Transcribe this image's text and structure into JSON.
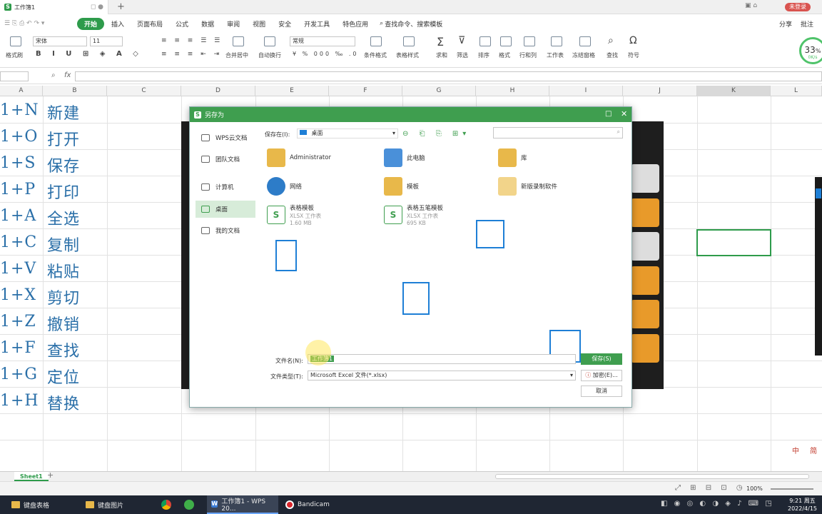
{
  "titlebar": {
    "tab_title": "工作簿1",
    "user_label": "未登录"
  },
  "menu": [
    "开始",
    "插入",
    "页面布局",
    "公式",
    "数据",
    "审阅",
    "视图",
    "安全",
    "开发工具",
    "特色应用"
  ],
  "menu_active": "开始",
  "search": "查找命令、搜索模板",
  "share": "分享",
  "comment": "批注",
  "ribbon": {
    "font": "宋体",
    "size": "11",
    "format": "常规",
    "labels": [
      "格式刷",
      "合并居中",
      "自动换行",
      "条件格式",
      "表格样式",
      "求和",
      "筛选",
      "排序",
      "格式",
      "行和列",
      "工作表",
      "冻结窗格",
      "查找",
      "符号"
    ]
  },
  "speed": {
    "value": "33",
    "unit": "%",
    "rate": "0K/s"
  },
  "formula": {
    "fx": "fx"
  },
  "columns": [
    "A",
    "B",
    "C",
    "D",
    "E",
    "F",
    "G",
    "H",
    "I",
    "J",
    "K",
    "L"
  ],
  "rows": [
    {
      "key": "1+N",
      "name": "新建"
    },
    {
      "key": "1+O",
      "name": "打开"
    },
    {
      "key": "1+S",
      "name": "保存"
    },
    {
      "key": "1+P",
      "name": "打印"
    },
    {
      "key": "1+A",
      "name": "全选"
    },
    {
      "key": "1+C",
      "name": "复制"
    },
    {
      "key": "1+V",
      "name": "粘贴"
    },
    {
      "key": "1+X",
      "name": "剪切"
    },
    {
      "key": "1+Z",
      "name": "撤销"
    },
    {
      "key": "1+F",
      "name": "查找"
    },
    {
      "key": "1+G",
      "name": "定位"
    },
    {
      "key": "1+H",
      "name": "替换"
    }
  ],
  "dialog": {
    "title": "另存为",
    "save_in_label": "保存在(I):",
    "save_in_value": "桌面",
    "sidebar": [
      "WPS云文档",
      "团队文档",
      "计算机",
      "桌面",
      "我的文档"
    ],
    "selected_sidebar": "桌面",
    "files": [
      {
        "name": "Administrator",
        "sub": "",
        "size": ""
      },
      {
        "name": "此电脑",
        "sub": "",
        "size": ""
      },
      {
        "name": "库",
        "sub": "",
        "size": ""
      },
      {
        "name": "网络",
        "sub": "",
        "size": ""
      },
      {
        "name": "模板",
        "sub": "",
        "size": ""
      },
      {
        "name": "新版录制软件",
        "sub": "",
        "size": ""
      },
      {
        "name": "表格模板",
        "sub": "XLSX 工作表",
        "size": "1.60 MB"
      },
      {
        "name": "表格五笔模板",
        "sub": "XLSX 工作表",
        "size": "695 KB"
      }
    ],
    "filename_label": "文件名(N):",
    "filename_value": "工作簿1",
    "filetype_label": "文件类型(T):",
    "filetype_value": "Microsoft Excel 文件(*.xlsx)",
    "save_button": "保存(S)",
    "encrypt_button": "加密(E)...",
    "cancel_button": "取消"
  },
  "sheet": {
    "name": "Sheet1"
  },
  "status": {
    "zoom": "100%"
  },
  "watermark": "中 简",
  "taskbar": {
    "items": [
      "键盘表格",
      "键盘图片",
      "",
      "",
      "工作簿1 - WPS 20...",
      "Bandicam"
    ],
    "time": "9:21 周五",
    "date": "2022/4/15"
  },
  "colors": {
    "accent": "#3f9e4f",
    "highlight": "#1e7fd6",
    "cell_text": "#2a6fa8"
  }
}
